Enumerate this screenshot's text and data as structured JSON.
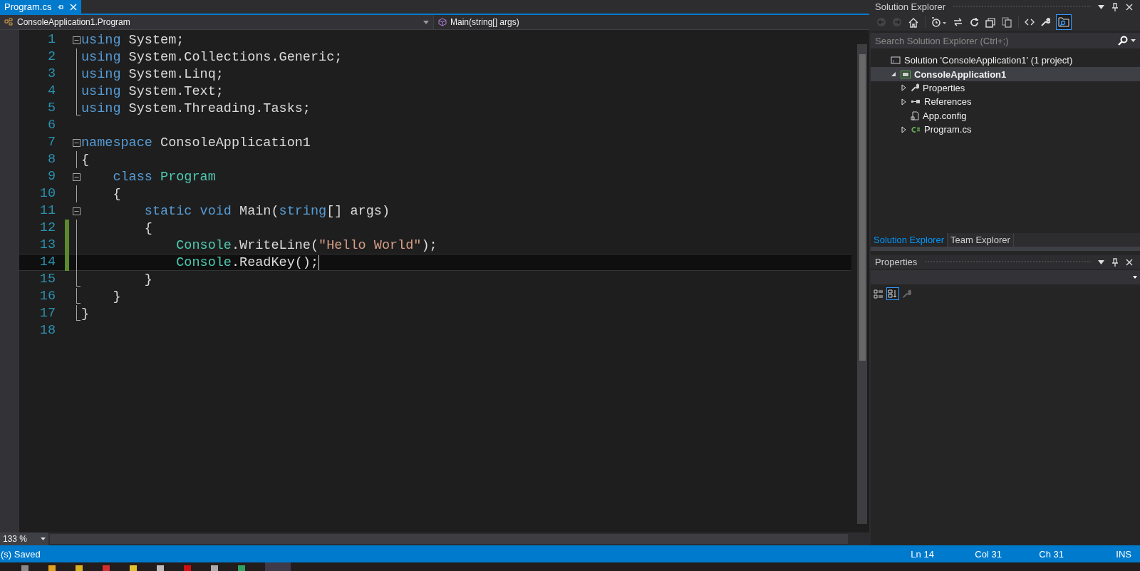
{
  "document_tab": {
    "label": "Program.cs",
    "selected": true
  },
  "nav_bar": {
    "type_dropdown": "ConsoleApplication1.Program",
    "member_dropdown": "Main(string[] args)"
  },
  "editor": {
    "zoom": "133 %",
    "lines": [
      {
        "number": "1",
        "kind": "fold_start",
        "changed": false,
        "current": false,
        "tokens": [
          {
            "text": "using",
            "kind": "keyword"
          },
          {
            "text": " System;",
            "kind": "plain"
          }
        ]
      },
      {
        "number": "2",
        "kind": "fold_line",
        "changed": false,
        "current": false,
        "tokens": [
          {
            "text": "using",
            "kind": "keyword"
          },
          {
            "text": " System.Collections.Generic;",
            "kind": "plain"
          }
        ]
      },
      {
        "number": "3",
        "kind": "fold_line",
        "changed": false,
        "current": false,
        "tokens": [
          {
            "text": "using",
            "kind": "keyword"
          },
          {
            "text": " System.Linq;",
            "kind": "plain"
          }
        ]
      },
      {
        "number": "4",
        "kind": "fold_line",
        "changed": false,
        "current": false,
        "tokens": [
          {
            "text": "using",
            "kind": "keyword"
          },
          {
            "text": " System.Text;",
            "kind": "plain"
          }
        ]
      },
      {
        "number": "5",
        "kind": "fold_end",
        "changed": false,
        "current": false,
        "tokens": [
          {
            "text": "using",
            "kind": "keyword"
          },
          {
            "text": " System.Threading.Tasks;",
            "kind": "plain"
          }
        ]
      },
      {
        "number": "6",
        "kind": "blank",
        "changed": false,
        "current": false
      },
      {
        "number": "7",
        "kind": "fold_start",
        "changed": false,
        "current": false,
        "tokens": [
          {
            "text": "namespace",
            "kind": "keyword"
          },
          {
            "text": " ConsoleApplication1",
            "kind": "plain"
          }
        ]
      },
      {
        "number": "8",
        "kind": "fold_line",
        "changed": false,
        "current": false,
        "tokens": [
          {
            "text": "{",
            "kind": "plain"
          }
        ]
      },
      {
        "number": "9",
        "kind": "fold_start",
        "changed": false,
        "current": false,
        "tokens": [
          {
            "text": "    class ",
            "kind": "keyword"
          },
          {
            "text": "Program",
            "kind": "type"
          }
        ]
      },
      {
        "number": "10",
        "kind": "fold_line",
        "changed": false,
        "current": false,
        "tokens": [
          {
            "text": "    {",
            "kind": "plain"
          }
        ]
      },
      {
        "number": "11",
        "kind": "fold_start",
        "changed": false,
        "current": false,
        "tokens": [
          {
            "text": "        static void ",
            "kind": "keyword"
          },
          {
            "text": "Main(",
            "kind": "plain"
          },
          {
            "text": "string",
            "kind": "keyword"
          },
          {
            "text": "[] args)",
            "kind": "plain"
          }
        ]
      },
      {
        "number": "12",
        "kind": "fold_line",
        "changed": true,
        "current": false,
        "tokens": [
          {
            "text": "        {",
            "kind": "plain"
          }
        ]
      },
      {
        "number": "13",
        "kind": "fold_line",
        "changed": true,
        "current": false,
        "tokens": [
          {
            "text": "            Console",
            "kind": "type"
          },
          {
            "text": ".WriteLine(",
            "kind": "plain"
          },
          {
            "text": "\"Hello World\"",
            "kind": "string"
          },
          {
            "text": ");",
            "kind": "plain"
          }
        ]
      },
      {
        "number": "14",
        "kind": "fold_line",
        "changed": true,
        "current": true,
        "tokens": [
          {
            "text": "            Console",
            "kind": "type"
          },
          {
            "text": ".ReadKey();",
            "kind": "plain"
          }
        ]
      },
      {
        "number": "15",
        "kind": "fold_end",
        "changed": false,
        "current": false,
        "tokens": [
          {
            "text": "        }",
            "kind": "plain"
          }
        ]
      },
      {
        "number": "16",
        "kind": "fold_end",
        "changed": false,
        "current": false,
        "tokens": [
          {
            "text": "    }",
            "kind": "plain"
          }
        ]
      },
      {
        "number": "17",
        "kind": "fold_end",
        "changed": false,
        "current": false,
        "tokens": [
          {
            "text": "}",
            "kind": "plain"
          }
        ]
      },
      {
        "number": "18",
        "kind": "blank",
        "changed": false,
        "current": false
      }
    ]
  },
  "solution_explorer": {
    "title": "Solution Explorer",
    "search": {
      "placeholder": "Search Solution Explorer (Ctrl+;)"
    },
    "tree": [
      {
        "label": "Solution 'ConsoleApplication1' (1 project)",
        "kind": "solution",
        "expandable": false,
        "selected": false,
        "children": [
          {
            "label": "ConsoleApplication1",
            "kind": "project",
            "expandable": true,
            "expanded": true,
            "selected": true,
            "children": [
              {
                "label": "Properties",
                "kind": "properties",
                "expandable": true,
                "expanded": false,
                "selected": false
              },
              {
                "label": "References",
                "kind": "references",
                "expandable": true,
                "expanded": false,
                "selected": false
              },
              {
                "label": "App.config",
                "kind": "config",
                "expandable": false,
                "expanded": false,
                "selected": false
              },
              {
                "label": "Program.cs",
                "kind": "csharp",
                "expandable": true,
                "expanded": false,
                "selected": false
              }
            ]
          }
        ]
      }
    ],
    "tabs": [
      {
        "label": "Solution Explorer",
        "selected": true
      },
      {
        "label": "Team Explorer",
        "selected": false
      }
    ]
  },
  "properties": {
    "title": "Properties"
  },
  "status_bar": {
    "message": "(s) Saved",
    "line": "Ln 14",
    "column": "Col 31",
    "char": "Ch 31",
    "mode": "INS"
  }
}
